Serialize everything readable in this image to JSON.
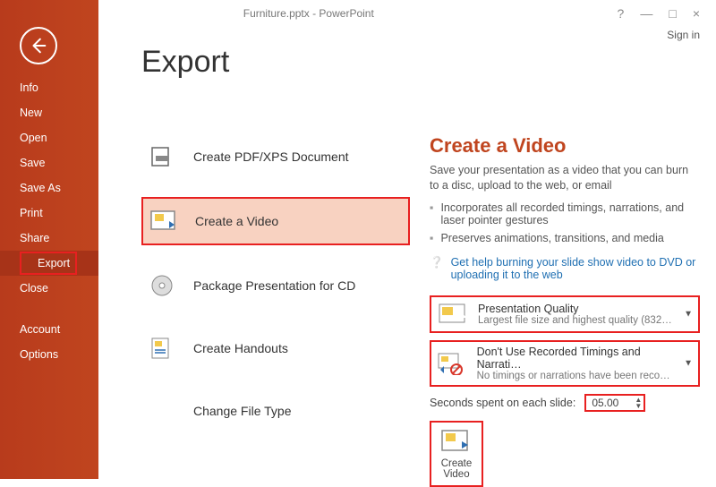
{
  "window": {
    "title": "Furniture.pptx - PowerPoint",
    "signin": "Sign in"
  },
  "sidebar": {
    "items": [
      {
        "label": "Info"
      },
      {
        "label": "New"
      },
      {
        "label": "Open"
      },
      {
        "label": "Save"
      },
      {
        "label": "Save As"
      },
      {
        "label": "Print"
      },
      {
        "label": "Share"
      },
      {
        "label": "Export"
      },
      {
        "label": "Close"
      },
      {
        "label": "Account"
      },
      {
        "label": "Options"
      }
    ]
  },
  "page": {
    "title": "Export"
  },
  "export_options": [
    {
      "label": "Create PDF/XPS Document"
    },
    {
      "label": "Create a Video"
    },
    {
      "label": "Package Presentation for CD"
    },
    {
      "label": "Create Handouts"
    },
    {
      "label": "Change File Type"
    }
  ],
  "detail": {
    "heading": "Create a Video",
    "intro": "Save your presentation as a video that you can burn to a disc, upload to the web, or email",
    "bullets": [
      "Incorporates all recorded timings, narrations, and laser pointer gestures",
      "Preserves animations, transitions, and media"
    ],
    "help_link": "Get help burning your slide show video to DVD or uploading it to the web",
    "quality": {
      "line1": "Presentation Quality",
      "line2": "Largest file size and highest quality (832…"
    },
    "timings": {
      "line1": "Don't Use Recorded Timings and Narrati…",
      "line2": "No timings or narrations have been reco…"
    },
    "seconds_label": "Seconds spent on each slide:",
    "seconds_value": "05.00",
    "create_button_line1": "Create",
    "create_button_line2": "Video"
  }
}
